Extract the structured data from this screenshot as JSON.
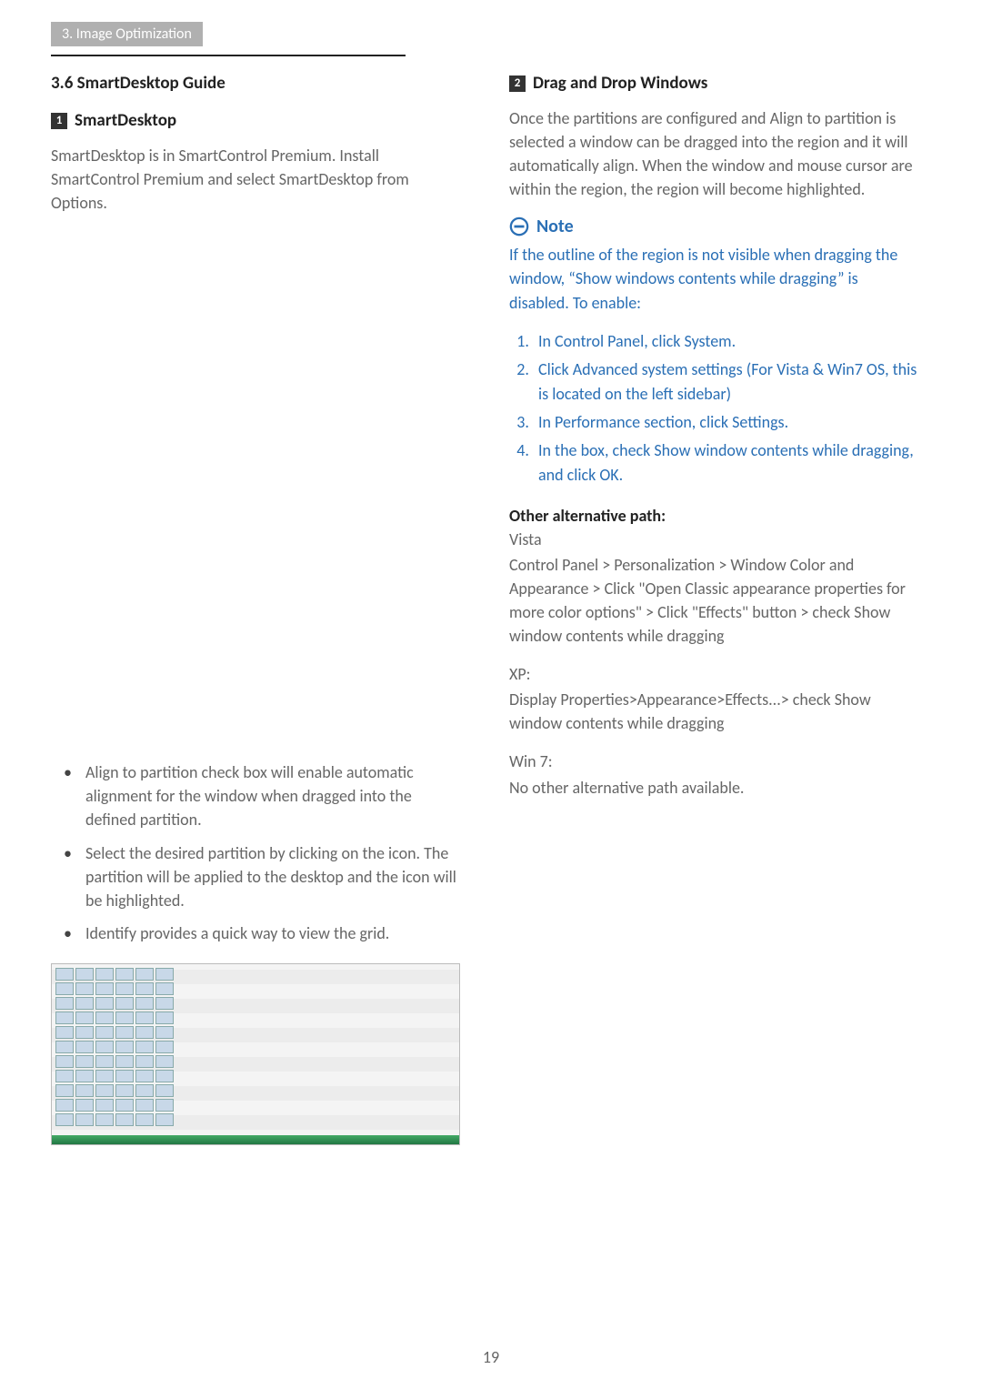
{
  "header": {
    "breadcrumb": "3. Image Optimization"
  },
  "left": {
    "section_title": "3.6 SmartDesktop Guide",
    "num1": "1",
    "sub1_title": "SmartDesktop",
    "intro": "SmartDesktop is in SmartControl Premium.  Install SmartControl Premium and select SmartDesktop from Options.",
    "bullets": [
      "Align to partition check box will enable automatic alignment for the window when dragged into the defined partition.",
      "Select the desired partition by clicking on the icon. The partition will be applied to the desktop and the icon will be highlighted.",
      "Identify provides a quick way to view the grid."
    ]
  },
  "right": {
    "num2": "2",
    "sub2_title": "Drag and Drop Windows",
    "p1": "Once the partitions are configured and Align to partition is selected a window can be dragged into the region and it will automatically align. When the window and mouse cursor are within the region, the region will become highlighted.",
    "note_label": "Note",
    "note_text": "If the outline of the region is not visible when dragging the window, “Show windows contents while dragging” is disabled.  To enable:",
    "note_steps": [
      "In Control Panel, click System.",
      "Click Advanced system settings  (For Vista & Win7 OS, this is located on the left sidebar)",
      "In Performance section, click Settings.",
      "In the box, check Show window contents while dragging, and click OK."
    ],
    "alt_title": "Other alternative path:",
    "vista_label": "Vista",
    "vista_text": "Control Panel > Personalization > Window Color and Appearance > Click \"Open Classic appearance properties for more color options\" > Click \"Effects\" button > check Show window contents while dragging",
    "xp_label": "XP:",
    "xp_text": " Display Properties>Appearance>Effects...> check Show window contents while dragging",
    "win7_label": "Win 7:",
    "win7_text": "No other alternative path available."
  },
  "page_number": "19"
}
